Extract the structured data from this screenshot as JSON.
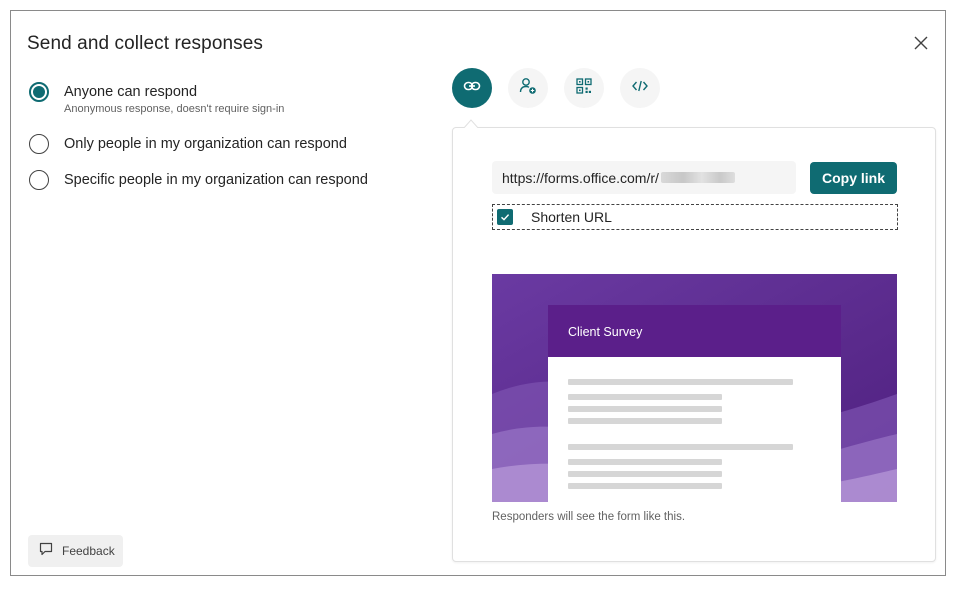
{
  "dialog": {
    "title": "Send and collect responses",
    "close_icon": "close-icon"
  },
  "options": [
    {
      "label": "Anyone can respond",
      "description": "Anonymous response, doesn't require sign-in",
      "selected": true
    },
    {
      "label": "Only people in my organization can respond",
      "selected": false
    },
    {
      "label": "Specific people in my organization can respond",
      "selected": false
    }
  ],
  "tabs": [
    {
      "icon": "link-icon",
      "active": true
    },
    {
      "icon": "person-add-icon",
      "active": false
    },
    {
      "icon": "qr-code-icon",
      "active": false
    },
    {
      "icon": "embed-code-icon",
      "active": false
    }
  ],
  "share": {
    "url": "https://forms.office.com/r/",
    "copy_label": "Copy link",
    "shorten_label": "Shorten URL",
    "shorten_checked": true
  },
  "preview": {
    "form_title": "Client Survey",
    "caption": "Responders will see the form like this."
  },
  "feedback": {
    "label": "Feedback",
    "icon": "comment-icon"
  },
  "colors": {
    "accent": "#0f6b72",
    "preview_purple": "#5b1f8a"
  }
}
